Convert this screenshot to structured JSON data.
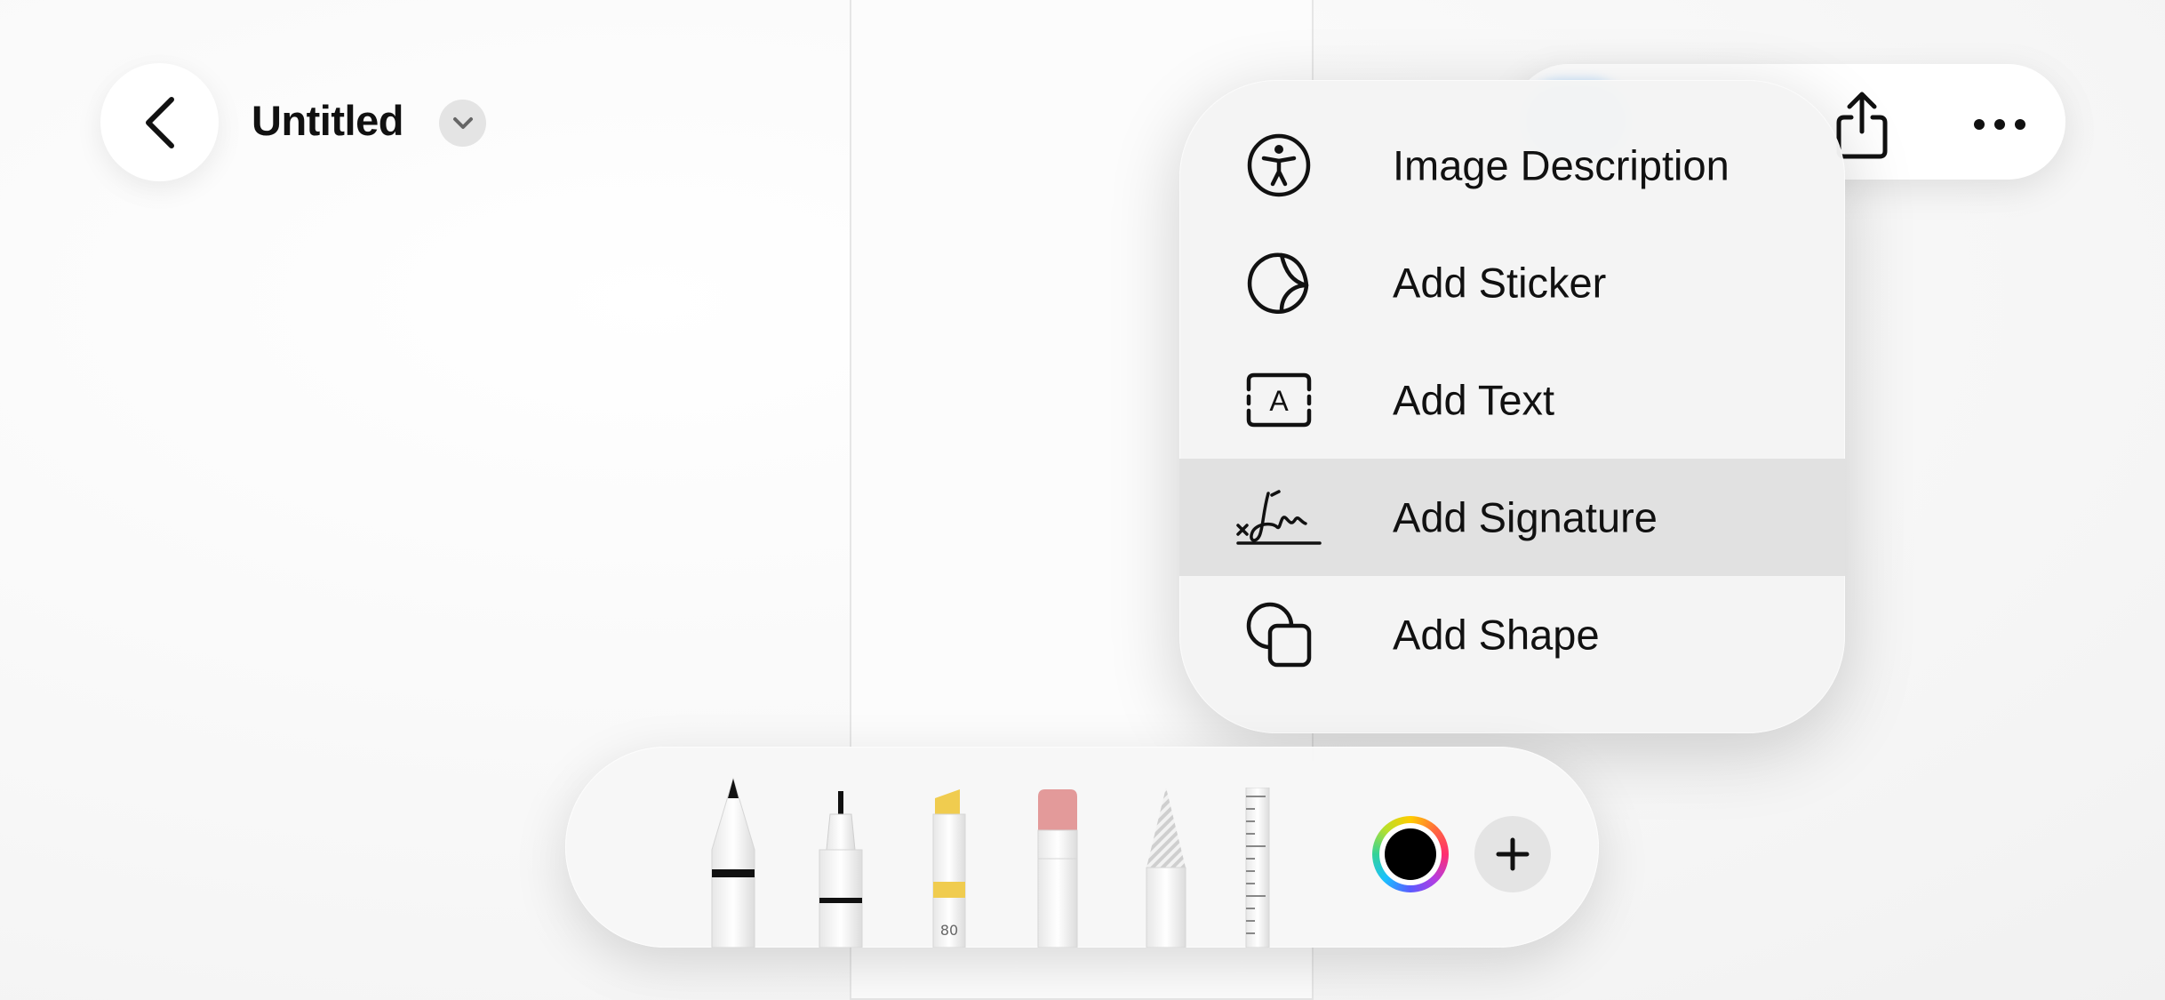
{
  "header": {
    "title": "Untitled"
  },
  "menu": {
    "items": [
      {
        "label": "Image Description",
        "icon": "accessibility-icon"
      },
      {
        "label": "Add Sticker",
        "icon": "sticker-icon"
      },
      {
        "label": "Add Text",
        "icon": "text-box-icon"
      },
      {
        "label": "Add Signature",
        "icon": "signature-icon",
        "highlighted": true
      },
      {
        "label": "Add Shape",
        "icon": "shapes-icon"
      }
    ]
  },
  "palette": {
    "tools": [
      "pen",
      "fineliner",
      "highlighter",
      "eraser",
      "pencil",
      "ruler"
    ],
    "highlighter_label": "80",
    "current_color": "#000000",
    "highlighter_color": "#f0cc4f",
    "eraser_color": "#e39a9a"
  },
  "colors": {
    "accent_blue": "#bfe0ff",
    "menu_highlight": "#e1e1e1"
  }
}
